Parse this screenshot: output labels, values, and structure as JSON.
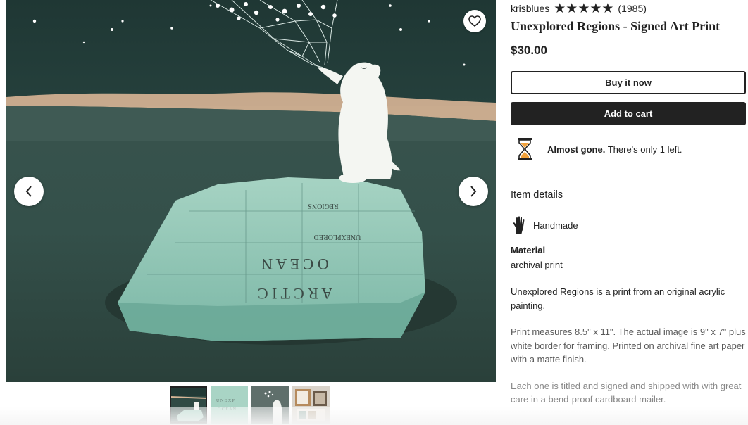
{
  "listing": {
    "shop_name": "krisblues",
    "stars": "★★★★★",
    "review_count": "(1985)",
    "title": "Unexplored Regions - Signed Art Print",
    "price": "$30.00"
  },
  "actions": {
    "buy_now_label": "Buy it now",
    "add_to_cart_label": "Add to cart"
  },
  "stock": {
    "emphasis": "Almost gone.",
    "message": " There's only 1 left."
  },
  "item_details": {
    "heading": "Item details",
    "feature_label": "Handmade",
    "material_label": "Material",
    "material_value": "archival print"
  },
  "description": {
    "p1": "Unexplored Regions is a print from an original acrylic painting.",
    "p2": "Print measures 8.5\" x 11\". The actual image is 9\" x 7\" plus white border for framing. Printed on archival fine art paper with a matte finish.",
    "p3": "Each one is titled and signed and shipped with with great care in a bend-proof cardboard mailer."
  },
  "artwork": {
    "iceberg_rows": [
      [
        "R",
        "E",
        "G",
        "I",
        "O",
        "N",
        "S"
      ],
      [
        "U",
        "N",
        "E",
        "X",
        "P",
        "L",
        "O",
        "R",
        "E",
        "D"
      ],
      [
        "O",
        "C",
        "E",
        "A",
        "N"
      ],
      [
        "A",
        "R",
        "C",
        "T",
        "I",
        "C"
      ]
    ]
  },
  "icons": {
    "favorite": "heart-icon",
    "prev": "chevron-left-icon",
    "next": "chevron-right-icon",
    "stock": "hourglass-icon",
    "handmade": "hand-icon"
  },
  "colors": {
    "accent_dark": "#222222",
    "hourglass_sand": "#f1a13b"
  }
}
